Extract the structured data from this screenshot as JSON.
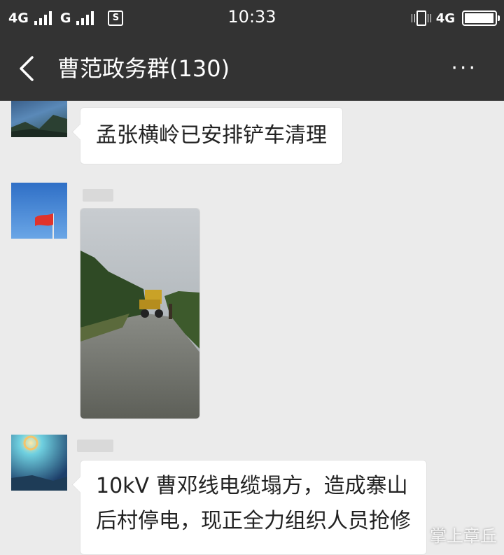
{
  "status_bar": {
    "network1": "4G",
    "network2": "G",
    "app_icon": "S",
    "time": "10:33",
    "network3": "4G",
    "battery_level": 0.98
  },
  "nav": {
    "title": "曹范政务群(130)",
    "more_label": "···",
    "back_icon": "chevron-left-icon"
  },
  "messages": [
    {
      "type": "text",
      "text": "孟张横岭已安排铲车清理"
    },
    {
      "type": "image",
      "description_hidden": true
    },
    {
      "type": "text",
      "lines": [
        "10kV 曹邓线电缆塌方，造成寨山",
        "后村停电，现正全力组织人员抢修"
      ]
    }
  ],
  "watermark": "掌上章丘",
  "colors": {
    "bar": "#333333",
    "chat_bg": "#ebebeb",
    "bubble": "#ffffff"
  }
}
